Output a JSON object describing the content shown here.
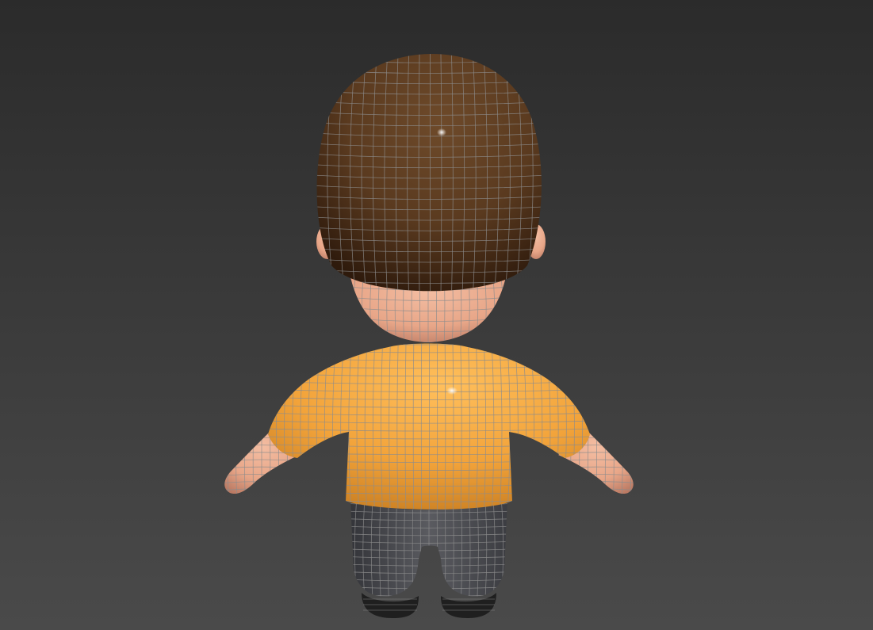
{
  "viewport": {
    "background_top": "#2b2b2b",
    "background_bottom": "#4a4a4a",
    "wire_color": "#8c8c8c"
  },
  "model": {
    "hair_color": "#5a3a1f",
    "hair_shadow": "#2e1a0c",
    "skin_color": "#e8a688",
    "skin_shadow": "#b87862",
    "shirt_color": "#f2a33a",
    "shirt_shadow": "#c47a1f",
    "pants_color": "#5a5b60",
    "pants_shadow": "#34353a",
    "shoe_color": "#1f1f1f"
  }
}
